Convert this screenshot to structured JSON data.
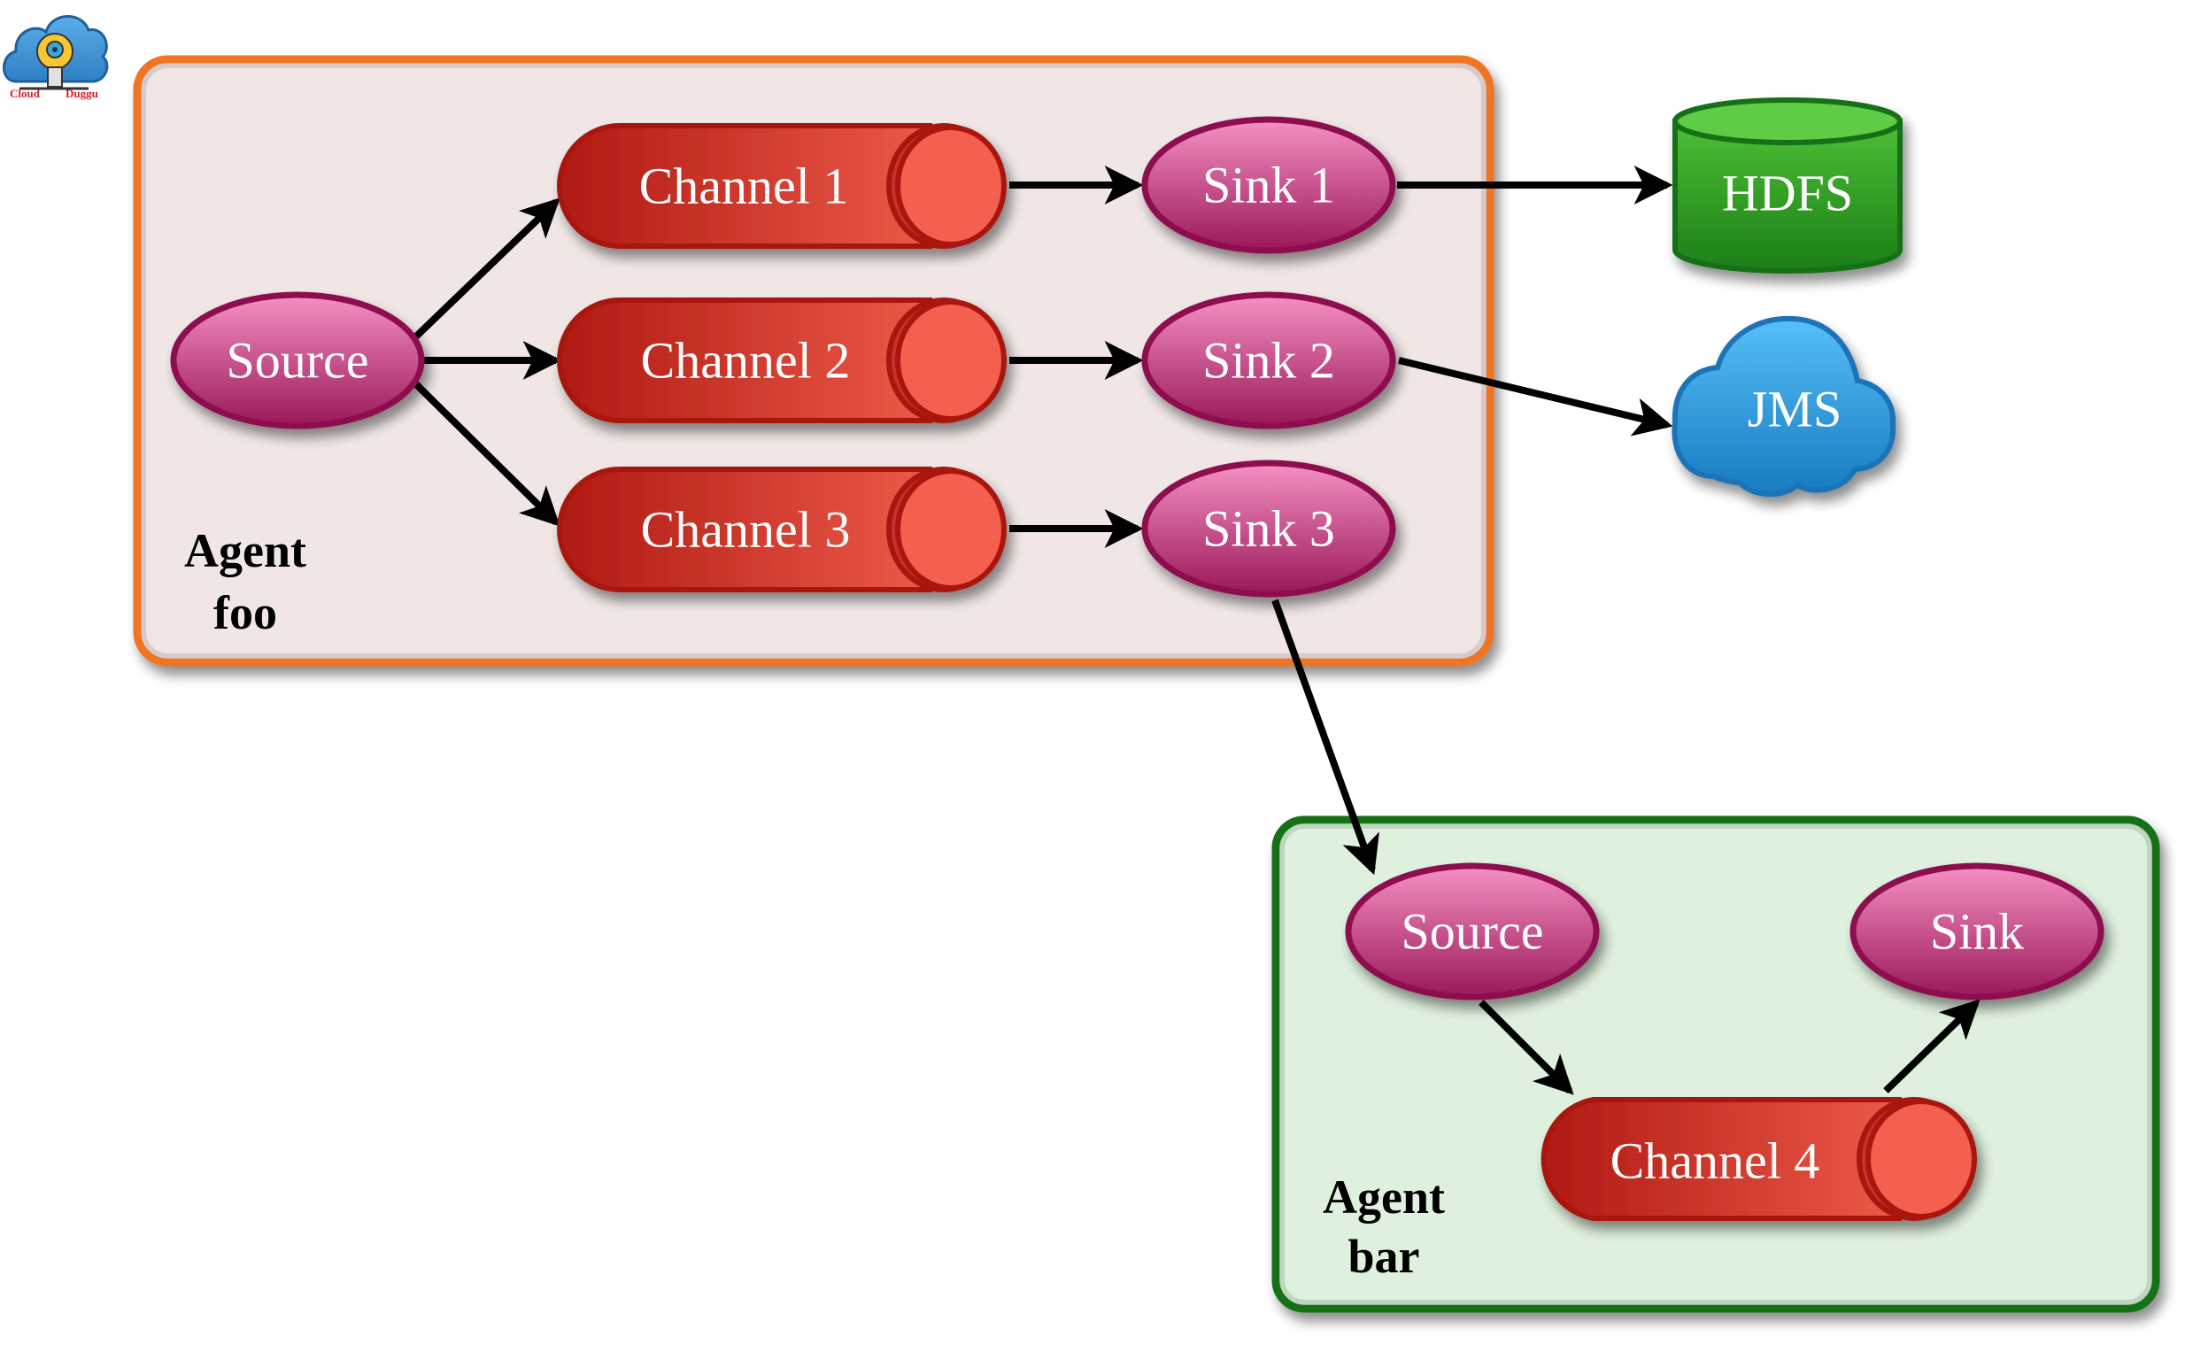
{
  "logo": {
    "left_text": "Cloud",
    "right_text": "Duggu"
  },
  "agents": {
    "foo": {
      "label_line1": "Agent",
      "label_line2": "foo",
      "border_color": "#ef7524",
      "fill_color": "#f0e6e6"
    },
    "bar": {
      "label_line1": "Agent",
      "label_line2": "bar",
      "border_color": "#147014",
      "fill_color": "#dff0df"
    }
  },
  "nodes": {
    "foo_source": "Source",
    "channel1": "Channel 1",
    "channel2": "Channel 2",
    "channel3": "Channel 3",
    "sink1": "Sink 1",
    "sink2": "Sink 2",
    "sink3": "Sink 3",
    "hdfs": "HDFS",
    "jms": "JMS",
    "bar_source": "Source",
    "bar_sink": "Sink",
    "channel4": "Channel 4"
  },
  "edges": [
    {
      "from": "foo_source",
      "to": "channel1"
    },
    {
      "from": "foo_source",
      "to": "channel2"
    },
    {
      "from": "foo_source",
      "to": "channel3"
    },
    {
      "from": "channel1",
      "to": "sink1"
    },
    {
      "from": "channel2",
      "to": "sink2"
    },
    {
      "from": "channel3",
      "to": "sink3"
    },
    {
      "from": "sink1",
      "to": "hdfs"
    },
    {
      "from": "sink2",
      "to": "jms"
    },
    {
      "from": "sink3",
      "to": "bar_source"
    },
    {
      "from": "bar_source",
      "to": "channel4"
    },
    {
      "from": "channel4",
      "to": "bar_sink"
    }
  ],
  "colors": {
    "ellipse_top": "#f48cbf",
    "ellipse_bottom": "#9c1a5a",
    "ellipse_stroke": "#8e1150",
    "channel_dark": "#b21b14",
    "channel_light": "#ea5a48",
    "channel_cap": "#f46050",
    "hdfs_top": "#5fcf45",
    "hdfs_bottom": "#1f851a",
    "hdfs_stroke": "#137013",
    "jms_top": "#55bdf7",
    "jms_bottom": "#1a7dc2",
    "jms_stroke": "#1a73b7"
  }
}
